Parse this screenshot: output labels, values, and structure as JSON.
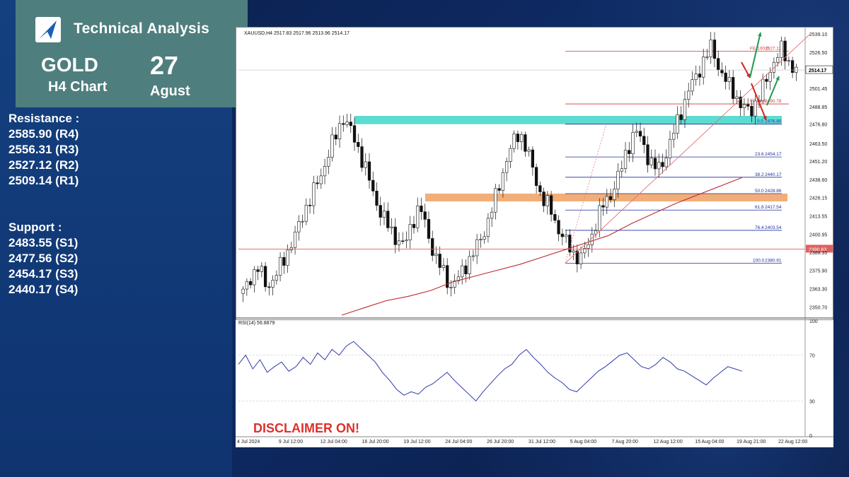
{
  "header": {
    "app_title": "Technical Analysis",
    "asset": "GOLD",
    "timeframe": "H4 Chart",
    "day": "27",
    "month": "Agust"
  },
  "resistance": {
    "title": "Resistance :",
    "levels": [
      "2585.90 (R4)",
      "2556.31 (R3)",
      "2527.12 (R2)",
      "2509.14 (R1)"
    ]
  },
  "support": {
    "title": "Support :",
    "levels": [
      "2483.55 (S1)",
      "2477.56 (S2)",
      "2454.17 (S3)",
      "2440.17 (S4)"
    ]
  },
  "disclaimer": "DISCLAIMER ON!",
  "colors": {
    "teal_zone": "#3fd6c8",
    "orange_zone": "#f0a060",
    "fib_line": "#1f2fa0",
    "fe_line": "#d43a3a",
    "ma_line": "#c0282c",
    "rsi_line": "#2d3aa8",
    "up_arrow": "#1f9a4a",
    "down_arrow": "#d42020"
  },
  "chart_data": {
    "type": "candlestick",
    "symbol_info": "XAUUSD,H4  2517.83 2517.96 2513.96 2514.17",
    "current_price_label": "2514.17",
    "ylim": [
      2345,
      2542
    ],
    "y_ticks": [
      "2539.10",
      "2526.50",
      "2514.17",
      "2501.45",
      "2488.85",
      "2476.80",
      "2463.50",
      "2451.20",
      "2438.60",
      "2426.15",
      "2413.55",
      "2400.95",
      "2388.35",
      "2375.90",
      "2363.30",
      "2350.70"
    ],
    "x_ticks": [
      "4 Jul 2024",
      "9 Jul 12:00",
      "12 Jul 04:00",
      "16 Jul 20:00",
      "19 Jul 12:00",
      "24 Jul 04:00",
      "26 Jul 20:00",
      "31 Jul 12:00",
      "5 Aug 04:00",
      "7 Aug 20:00",
      "12 Aug 12:00",
      "15 Aug 04:00",
      "19 Aug 21:00",
      "22 Aug 12:00"
    ],
    "fib_levels": [
      {
        "ratio": "0.0",
        "price": "2476.80"
      },
      {
        "ratio": "23.6",
        "price": "2454.17"
      },
      {
        "ratio": "38.2",
        "price": "2440.17"
      },
      {
        "ratio": "50.0",
        "price": "2428.86"
      },
      {
        "ratio": "61.8",
        "price": "2417.54"
      },
      {
        "ratio": "76.4",
        "price": "2403.54"
      },
      {
        "ratio": "100.0",
        "price": "2380.91"
      }
    ],
    "fe_levels": [
      {
        "label": "FE 100.0",
        "price": "2527.12"
      },
      {
        "label": "FE 61.8",
        "price": "2490.78"
      }
    ],
    "highlight_line_label": "2390.63",
    "zones": [
      {
        "name": "resistance-zone",
        "low": 2476.8,
        "high": 2482.5
      },
      {
        "name": "support-zone",
        "low": 2423.5,
        "high": 2428.9
      }
    ],
    "close_path": [
      2360,
      2372,
      2378,
      2365,
      2370,
      2380,
      2392,
      2402,
      2418,
      2428,
      2440,
      2455,
      2468,
      2482,
      2472,
      2460,
      2445,
      2428,
      2415,
      2405,
      2398,
      2392,
      2410,
      2420,
      2402,
      2385,
      2375,
      2365,
      2370,
      2380,
      2388,
      2398,
      2412,
      2428,
      2448,
      2462,
      2472,
      2458,
      2440,
      2425,
      2418,
      2405,
      2395,
      2388,
      2384,
      2395,
      2410,
      2422,
      2430,
      2442,
      2460,
      2472,
      2465,
      2450,
      2445,
      2455,
      2470,
      2486,
      2500,
      2510,
      2522,
      2530,
      2515,
      2505,
      2498,
      2488,
      2485,
      2495,
      2505,
      2520,
      2528,
      2520,
      2514
    ],
    "ma_path": [
      2345,
      2350,
      2355,
      2358,
      2362,
      2368,
      2372,
      2376,
      2380,
      2385,
      2390,
      2395,
      2400,
      2408,
      2415,
      2422,
      2428,
      2434,
      2440
    ],
    "rsi": {
      "label": "RSI(14) 56.8879",
      "ylim": [
        0,
        100
      ],
      "y_ticks": [
        "100",
        "70",
        "30",
        "0"
      ],
      "values": [
        62,
        70,
        58,
        66,
        55,
        60,
        64,
        56,
        60,
        68,
        62,
        72,
        66,
        75,
        70,
        78,
        82,
        76,
        70,
        64,
        55,
        48,
        40,
        35,
        38,
        36,
        42,
        45,
        50,
        55,
        48,
        42,
        36,
        30,
        38,
        45,
        52,
        58,
        62,
        70,
        75,
        68,
        62,
        55,
        50,
        46,
        40,
        38,
        44,
        50,
        56,
        60,
        65,
        70,
        72,
        66,
        60,
        58,
        62,
        68,
        64,
        58,
        56,
        52,
        48,
        44,
        50,
        55,
        60,
        58,
        56
      ]
    }
  }
}
